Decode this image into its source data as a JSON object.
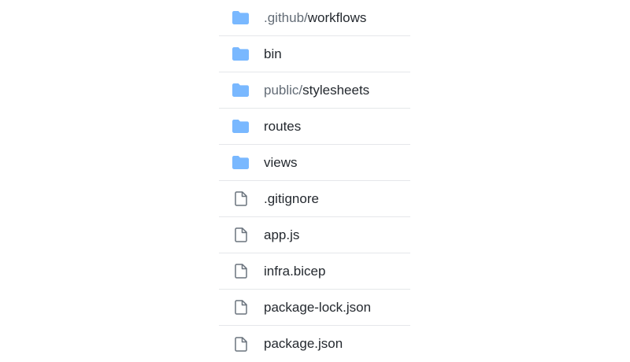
{
  "colors": {
    "folder_icon": "#79b8ff",
    "file_icon": "#6a737d",
    "text": "#24292f",
    "path_prefix": "#636c76",
    "divider": "#e5e7ea"
  },
  "entries": [
    {
      "type": "folder",
      "icon": "folder-icon",
      "prefix": ".github/",
      "name": "workflows"
    },
    {
      "type": "folder",
      "icon": "folder-icon",
      "prefix": "",
      "name": "bin"
    },
    {
      "type": "folder",
      "icon": "folder-icon",
      "prefix": "public/",
      "name": "stylesheets"
    },
    {
      "type": "folder",
      "icon": "folder-icon",
      "prefix": "",
      "name": "routes"
    },
    {
      "type": "folder",
      "icon": "folder-icon",
      "prefix": "",
      "name": "views"
    },
    {
      "type": "file",
      "icon": "file-icon",
      "prefix": "",
      "name": ".gitignore"
    },
    {
      "type": "file",
      "icon": "file-icon",
      "prefix": "",
      "name": "app.js"
    },
    {
      "type": "file",
      "icon": "file-icon",
      "prefix": "",
      "name": "infra.bicep"
    },
    {
      "type": "file",
      "icon": "file-icon",
      "prefix": "",
      "name": "package-lock.json"
    },
    {
      "type": "file",
      "icon": "file-icon",
      "prefix": "",
      "name": "package.json"
    }
  ]
}
